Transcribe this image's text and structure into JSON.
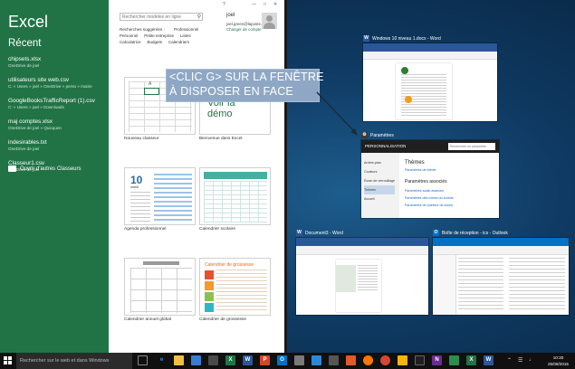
{
  "excel": {
    "app_title": "Excel",
    "recent_title": "Récent",
    "recent_files": [
      {
        "name": "chipsets.xlsx",
        "path": "OneDrive de joel"
      },
      {
        "name": "utilisateurs site web.csv",
        "path": "C: » Users » joel » OneDrive » perso » mairie"
      },
      {
        "name": "GoogleBooksTrafficReport (1).csv",
        "path": "C: » Users » joel » Downloads"
      },
      {
        "name": "maj comptes.xlsx",
        "path": "OneDrive de joel » Quicquen"
      },
      {
        "name": "indesirables.txt",
        "path": "OneDrive de joel"
      },
      {
        "name": "Classeur1.csv",
        "path": "OneDrive de joel"
      }
    ],
    "open_other": "Ouvrir d'autres Classeurs",
    "search_placeholder": "Rechercher modèles en ligne",
    "help": "?",
    "user": {
      "name": "joel",
      "email": "joel.green@laposte.net",
      "change_account": "Changer de compte"
    },
    "suggestions_label": "Recherches suggérées :",
    "categories_row1": [
      "Professionnel",
      "Personnel",
      "Petite entreprise",
      "Listes"
    ],
    "categories_row2": [
      "Calculatrice",
      "Budgets",
      "Calendriers"
    ],
    "templates": [
      {
        "label": "Nouveau classeur",
        "col_header": "A"
      },
      {
        "label": "Bienvenue dans Excel",
        "text_line1": "Voir la",
        "text_line2": "démo"
      },
      {
        "label": "Agenda professionnel",
        "date": "10",
        "sub": "mardi"
      },
      {
        "label": "Calendrier scolaire"
      },
      {
        "label": "Calendrier annuel global"
      },
      {
        "label": "Calendrier de grossesse",
        "title": "Calendrier de grossesse"
      }
    ]
  },
  "callout": {
    "line1": "<CLIC G> SUR LA FENÊTRE",
    "line2": "À DISPOSER EN FACE"
  },
  "snap_windows": [
    {
      "title": "Windows 10 niveau 1.docx - Word",
      "app": "W",
      "color": "#2b579a"
    },
    {
      "title": "Paramètres",
      "app": "⚙",
      "color": "#3a3a3a",
      "header": "PERSONNALISATION",
      "search_placeholder": "Rechercher un paramètre",
      "menu": [
        "Arrière-plan",
        "Couleurs",
        "Écran de verrouillage",
        "Thèmes",
        "Accueil"
      ],
      "section1": "Thèmes",
      "link1": "Paramètres de thème",
      "section2": "Paramètres associés",
      "links2": [
        "Paramètres audio avancés",
        "Paramètres des icônes du bureau",
        "Paramètres de pointeur de souris"
      ]
    },
    {
      "title": "Document3 - Word",
      "app": "W",
      "color": "#2b579a"
    },
    {
      "title": "Boîte de réception - ics - Outlook",
      "app": "O",
      "color": "#0072c6"
    }
  ],
  "taskbar": {
    "search_placeholder": "Rechercher sur le web et dans Windows",
    "time": "10:30",
    "date": "25/08/2015"
  }
}
